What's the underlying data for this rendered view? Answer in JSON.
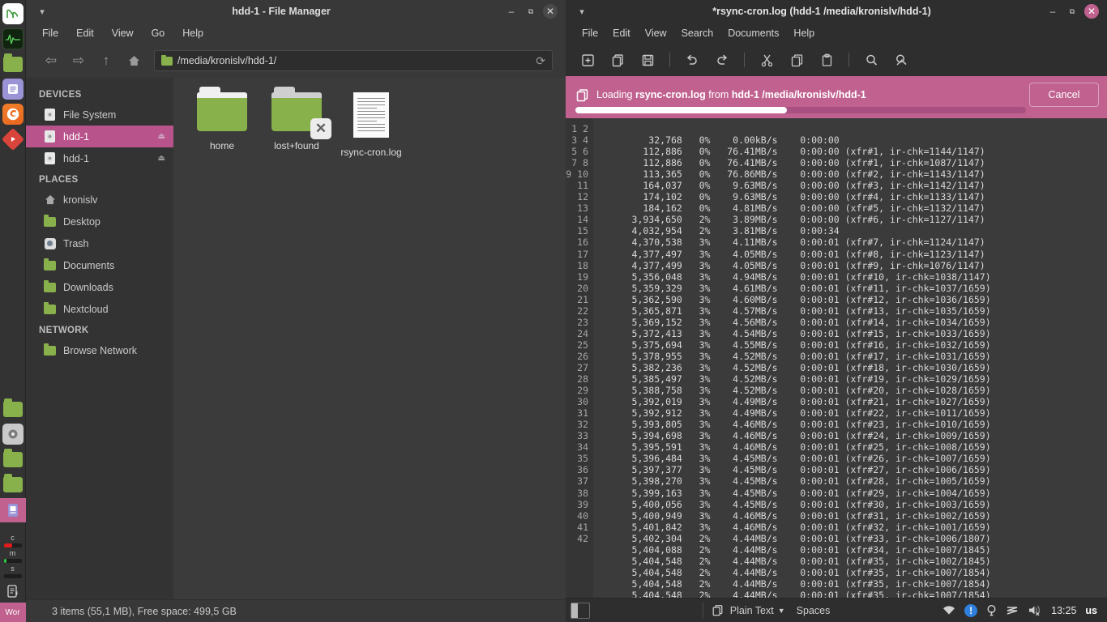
{
  "dock": {
    "items": [
      {
        "name": "mint-menu-icon",
        "label": "Menu"
      },
      {
        "name": "system-monitor-icon",
        "label": "System Monitor"
      },
      {
        "name": "file-manager-icon",
        "label": "Files"
      },
      {
        "name": "text-editor-icon",
        "label": "Text Editor"
      },
      {
        "name": "firefox-icon",
        "label": "Firefox"
      },
      {
        "name": "red-app-icon",
        "label": "App"
      },
      {
        "name": "folder-icon-2",
        "label": "Folder"
      },
      {
        "name": "media-icon",
        "label": "Media"
      },
      {
        "name": "folder-icon-3",
        "label": "Folder"
      },
      {
        "name": "folder-icon-4",
        "label": "Folder"
      },
      {
        "name": "editor-active-icon",
        "label": "Editor"
      }
    ],
    "monitors": [
      {
        "label": "c",
        "color": "#e01b1b",
        "pct": 48
      },
      {
        "label": "m",
        "color": "#2ecc40",
        "pct": 14
      },
      {
        "label": "s",
        "color": "#2ecc40",
        "pct": 0
      }
    ],
    "workspace_label": "Wor"
  },
  "file_manager": {
    "title": "hdd-1 - File Manager",
    "window_buttons": {
      "minimize": "–",
      "maximize": "❐",
      "close": "✕"
    },
    "menus": [
      "File",
      "Edit",
      "View",
      "Go",
      "Help"
    ],
    "toolbar": {
      "back": "⇦",
      "forward": "⇨",
      "up": "↑",
      "home": "⌂",
      "reload": "⟳"
    },
    "path": "/media/kronislv/hdd-1/",
    "sidebar": [
      {
        "type": "header",
        "label": "DEVICES"
      },
      {
        "type": "item",
        "label": "File System",
        "icon": "disk-icon",
        "selected": false,
        "eject": false
      },
      {
        "type": "item",
        "label": "hdd-1",
        "icon": "disk-icon",
        "selected": true,
        "eject": true
      },
      {
        "type": "item",
        "label": "hdd-1",
        "icon": "disk-icon",
        "selected": false,
        "eject": true
      },
      {
        "type": "header",
        "label": "PLACES"
      },
      {
        "type": "item",
        "label": "kronislv",
        "icon": "home-icon",
        "selected": false,
        "eject": false
      },
      {
        "type": "item",
        "label": "Desktop",
        "icon": "folder-icon",
        "selected": false,
        "eject": false
      },
      {
        "type": "item",
        "label": "Trash",
        "icon": "trash-icon",
        "selected": false,
        "eject": false
      },
      {
        "type": "item",
        "label": "Documents",
        "icon": "folder-icon",
        "selected": false,
        "eject": false
      },
      {
        "type": "item",
        "label": "Downloads",
        "icon": "folder-icon",
        "selected": false,
        "eject": false
      },
      {
        "type": "item",
        "label": "Nextcloud",
        "icon": "folder-icon",
        "selected": false,
        "eject": false
      },
      {
        "type": "header",
        "label": "NETWORK"
      },
      {
        "type": "item",
        "label": "Browse Network",
        "icon": "folder-icon",
        "selected": false,
        "eject": false
      }
    ],
    "files": [
      {
        "label": "home",
        "kind": "folder",
        "emblem": null
      },
      {
        "label": "lost+found",
        "kind": "folder-grey",
        "emblem": "x"
      },
      {
        "label": "rsync-cron.log",
        "kind": "document",
        "emblem": null
      }
    ],
    "status": "3 items (55,1 MB), Free space: 499,5 GB"
  },
  "editor": {
    "title": "*rsync-cron.log (hdd-1 /media/kronislv/hdd-1)",
    "window_buttons": {
      "minimize": "–",
      "maximize": "❐",
      "close": "✕"
    },
    "menus": [
      "File",
      "Edit",
      "View",
      "Search",
      "Documents",
      "Help"
    ],
    "toolbar_icons": [
      "new-document-icon",
      "open-document-icon",
      "save-icon",
      "undo-icon",
      "redo-icon",
      "cut-icon",
      "copy-icon",
      "paste-icon",
      "find-icon",
      "replace-icon"
    ],
    "loading": {
      "prefix": "Loading ",
      "filename": "rsync-cron.log",
      "middle": " from ",
      "location": "hdd-1 /media/kronislv/hdd-1",
      "cancel_label": "Cancel",
      "progress_pct": 47,
      "bar_color": "#c0618f"
    },
    "status": {
      "document_type": "Plain Text",
      "indent": "Spaces",
      "time": "13:25",
      "keyboard": "us"
    },
    "first_line_number": 1,
    "lines": [
      {
        "n": 1,
        "text": ""
      },
      {
        "n": 2,
        "text": "         32,768   0%    0.00kB/s    0:00:00"
      },
      {
        "n": 3,
        "text": "        112,886   0%   76.41MB/s    0:00:00 (xfr#1, ir-chk=1144/1147)"
      },
      {
        "n": 4,
        "text": "        112,886   0%   76.41MB/s    0:00:00 (xfr#1, ir-chk=1087/1147)"
      },
      {
        "n": 5,
        "text": "        113,365   0%   76.86MB/s    0:00:00 (xfr#2, ir-chk=1143/1147)"
      },
      {
        "n": 6,
        "text": "        164,037   0%    9.63MB/s    0:00:00 (xfr#3, ir-chk=1142/1147)"
      },
      {
        "n": 7,
        "text": "        174,102   0%    9.63MB/s    0:00:00 (xfr#4, ir-chk=1133/1147)"
      },
      {
        "n": 8,
        "text": "        184,162   0%    4.81MB/s    0:00:00 (xfr#5, ir-chk=1132/1147)"
      },
      {
        "n": 9,
        "text": "      3,934,650   2%    3.89MB/s    0:00:00 (xfr#6, ir-chk=1127/1147)"
      },
      {
        "n": 10,
        "text": "      4,032,954   2%    3.81MB/s    0:00:34"
      },
      {
        "n": 11,
        "text": "      4,370,538   3%    4.11MB/s    0:00:01 (xfr#7, ir-chk=1124/1147)"
      },
      {
        "n": 12,
        "text": "      4,377,497   3%    4.05MB/s    0:00:01 (xfr#8, ir-chk=1123/1147)"
      },
      {
        "n": 13,
        "text": "      4,377,499   3%    4.05MB/s    0:00:01 (xfr#9, ir-chk=1076/1147)"
      },
      {
        "n": 14,
        "text": "      5,356,048   3%    4.94MB/s    0:00:01 (xfr#10, ir-chk=1038/1147)"
      },
      {
        "n": 15,
        "text": "      5,359,329   3%    4.61MB/s    0:00:01 (xfr#11, ir-chk=1037/1659)"
      },
      {
        "n": 16,
        "text": "      5,362,590   3%    4.60MB/s    0:00:01 (xfr#12, ir-chk=1036/1659)"
      },
      {
        "n": 17,
        "text": "      5,365,871   3%    4.57MB/s    0:00:01 (xfr#13, ir-chk=1035/1659)"
      },
      {
        "n": 18,
        "text": "      5,369,152   3%    4.56MB/s    0:00:01 (xfr#14, ir-chk=1034/1659)"
      },
      {
        "n": 19,
        "text": "      5,372,413   3%    4.54MB/s    0:00:01 (xfr#15, ir-chk=1033/1659)"
      },
      {
        "n": 20,
        "text": "      5,375,694   3%    4.55MB/s    0:00:01 (xfr#16, ir-chk=1032/1659)"
      },
      {
        "n": 21,
        "text": "      5,378,955   3%    4.52MB/s    0:00:01 (xfr#17, ir-chk=1031/1659)"
      },
      {
        "n": 22,
        "text": "      5,382,236   3%    4.52MB/s    0:00:01 (xfr#18, ir-chk=1030/1659)"
      },
      {
        "n": 23,
        "text": "      5,385,497   3%    4.52MB/s    0:00:01 (xfr#19, ir-chk=1029/1659)"
      },
      {
        "n": 24,
        "text": "      5,388,758   3%    4.52MB/s    0:00:01 (xfr#20, ir-chk=1028/1659)"
      },
      {
        "n": 25,
        "text": "      5,392,019   3%    4.49MB/s    0:00:01 (xfr#21, ir-chk=1027/1659)"
      },
      {
        "n": 26,
        "text": "      5,392,912   3%    4.49MB/s    0:00:01 (xfr#22, ir-chk=1011/1659)"
      },
      {
        "n": 27,
        "text": "      5,393,805   3%    4.46MB/s    0:00:01 (xfr#23, ir-chk=1010/1659)"
      },
      {
        "n": 28,
        "text": "      5,394,698   3%    4.46MB/s    0:00:01 (xfr#24, ir-chk=1009/1659)"
      },
      {
        "n": 29,
        "text": "      5,395,591   3%    4.46MB/s    0:00:01 (xfr#25, ir-chk=1008/1659)"
      },
      {
        "n": 30,
        "text": "      5,396,484   3%    4.45MB/s    0:00:01 (xfr#26, ir-chk=1007/1659)"
      },
      {
        "n": 31,
        "text": "      5,397,377   3%    4.45MB/s    0:00:01 (xfr#27, ir-chk=1006/1659)"
      },
      {
        "n": 32,
        "text": "      5,398,270   3%    4.45MB/s    0:00:01 (xfr#28, ir-chk=1005/1659)"
      },
      {
        "n": 33,
        "text": "      5,399,163   3%    4.45MB/s    0:00:01 (xfr#29, ir-chk=1004/1659)"
      },
      {
        "n": 34,
        "text": "      5,400,056   3%    4.45MB/s    0:00:01 (xfr#30, ir-chk=1003/1659)"
      },
      {
        "n": 35,
        "text": "      5,400,949   3%    4.46MB/s    0:00:01 (xfr#31, ir-chk=1002/1659)"
      },
      {
        "n": 36,
        "text": "      5,401,842   3%    4.46MB/s    0:00:01 (xfr#32, ir-chk=1001/1659)"
      },
      {
        "n": 37,
        "text": "      5,402,304   2%    4.44MB/s    0:00:01 (xfr#33, ir-chk=1006/1807)"
      },
      {
        "n": 38,
        "text": "      5,404,088   2%    4.44MB/s    0:00:01 (xfr#34, ir-chk=1007/1845)"
      },
      {
        "n": 39,
        "text": "      5,404,548   2%    4.44MB/s    0:00:01 (xfr#35, ir-chk=1002/1845)"
      },
      {
        "n": 40,
        "text": "      5,404,548   2%    4.44MB/s    0:00:01 (xfr#35, ir-chk=1007/1854)"
      },
      {
        "n": 41,
        "text": "      5,404,548   2%    4.44MB/s    0:00:01 (xfr#35, ir-chk=1007/1854)"
      },
      {
        "n": 42,
        "text": "      5,404,548   2%    4.44MB/s    0:00:01 (xfr#35, ir-chk=1007/1854)"
      }
    ]
  }
}
